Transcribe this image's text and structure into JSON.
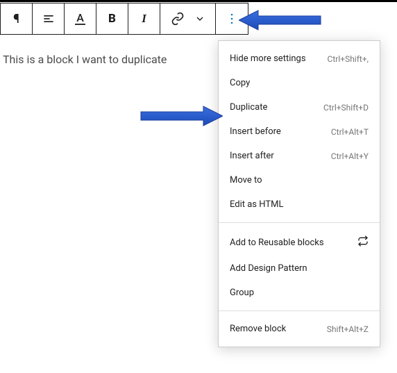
{
  "block_text": "This is a block I want to duplicate",
  "toolbar": {
    "paragraph": "¶",
    "bold": "B",
    "italic": "I"
  },
  "menu": {
    "section1": [
      {
        "label": "Hide more settings",
        "shortcut": "Ctrl+Shift+,"
      },
      {
        "label": "Copy",
        "shortcut": ""
      },
      {
        "label": "Duplicate",
        "shortcut": "Ctrl+Shift+D"
      },
      {
        "label": "Insert before",
        "shortcut": "Ctrl+Alt+T"
      },
      {
        "label": "Insert after",
        "shortcut": "Ctrl+Alt+Y"
      },
      {
        "label": "Move to",
        "shortcut": ""
      },
      {
        "label": "Edit as HTML",
        "shortcut": ""
      }
    ],
    "section2": [
      {
        "label": "Add to Reusable blocks",
        "shortcut": "",
        "iconRight": true
      },
      {
        "label": "Add Design Pattern",
        "shortcut": ""
      },
      {
        "label": "Group",
        "shortcut": ""
      }
    ],
    "section3": [
      {
        "label": "Remove block",
        "shortcut": "Shift+Alt+Z"
      }
    ]
  }
}
